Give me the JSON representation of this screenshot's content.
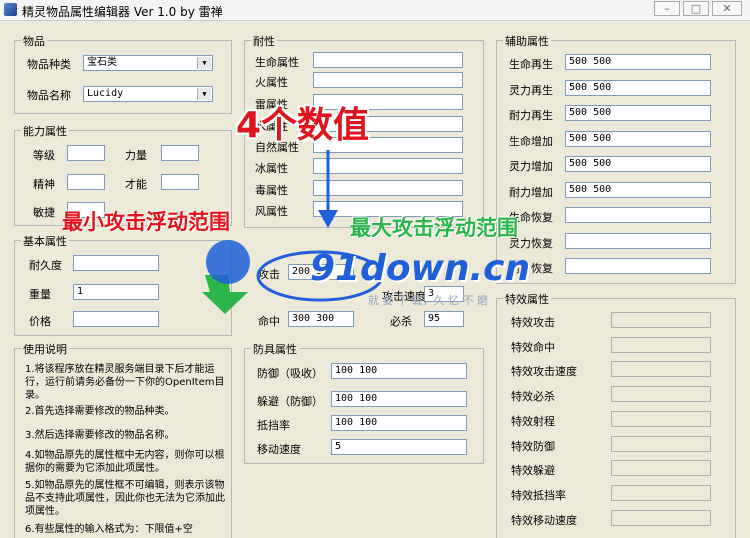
{
  "window": {
    "title": "精灵物品属性编辑器 Ver 1.0 by 雷禅",
    "min": "–",
    "max": "□",
    "close": "✕"
  },
  "item": {
    "title": "物品",
    "type_label": "物品种类",
    "type_value": "宝石类",
    "name_label": "物品名称",
    "name_value": "Lucidy"
  },
  "ability": {
    "title": "能力属性",
    "level": "等级",
    "power": "力量",
    "spirit": "精神",
    "talent": "才能",
    "agility": "敏捷"
  },
  "basic": {
    "title": "基本属性",
    "durability": "耐久度",
    "weight": "重量",
    "weight_value": "1",
    "price": "价格"
  },
  "help": {
    "title": "使用说明",
    "lines": [
      "1.将该程序放在精灵服务端目录下后才能运行，运行前请务必备份一下你的OpenItem目录。",
      "2.首先选择需要修改的物品种类。",
      "3.然后选择需要修改的物品名称。",
      "4.如物品原先的属性框中无内容，则你可以根据你的需要为它添加此项属性。",
      "5.如物品原先的属性框不可编辑，则表示该物品不支持此项属性，因此你也无法为它添加此项属性。",
      "6.有些属性的输入格式为：下限值+空"
    ]
  },
  "resist": {
    "title": "耐性",
    "labels": [
      "生命属性",
      "火属性",
      "雷属性",
      "水属性",
      "自然属性",
      "冰属性",
      "毒属性",
      "风属性"
    ]
  },
  "attack": {
    "attack_label": "攻击",
    "attack_value": "200 300",
    "speed_label": "攻击速度",
    "speed_value": "3",
    "hit_label": "命中",
    "hit_value": "300 300",
    "crit_label": "必杀",
    "crit_value": "95"
  },
  "armor": {
    "title": "防具属性",
    "defense_label": "防御（吸收）",
    "defense_value": "100 100",
    "evade_label": "躲避（防御）",
    "evade_value": "100 100",
    "block_label": "抵挡率",
    "block_value": "100 100",
    "move_label": "移动速度",
    "move_value": "5"
  },
  "aux": {
    "title": "辅助属性",
    "rows": [
      {
        "label": "生命再生",
        "value": "500 500"
      },
      {
        "label": "灵力再生",
        "value": "500 500"
      },
      {
        "label": "耐力再生",
        "value": "500 500"
      },
      {
        "label": "生命增加",
        "value": "500 500"
      },
      {
        "label": "灵力增加",
        "value": "500 500"
      },
      {
        "label": "耐力增加",
        "value": "500 500"
      },
      {
        "label": "生命恢复",
        "value": ""
      },
      {
        "label": "灵力恢复",
        "value": ""
      },
      {
        "label": "耐力恢复",
        "value": ""
      }
    ]
  },
  "special": {
    "title": "特效属性",
    "labels": [
      "特效攻击",
      "特效命中",
      "特效攻击速度",
      "特效必杀",
      "特效射程",
      "特效防御",
      "特效躲避",
      "特效抵挡率",
      "特效移动速度"
    ]
  },
  "overlay": {
    "four_values": "4个数值",
    "min_range": "最小攻击浮动范围",
    "max_range": "最大攻击浮动范围",
    "watermark": "91down.cn",
    "watermark_sub": "就 要 下 载，久 忆 不 磨"
  },
  "colors": {
    "red": "#e0141c",
    "green": "#2bb54a",
    "blue": "#1f5fd9"
  }
}
